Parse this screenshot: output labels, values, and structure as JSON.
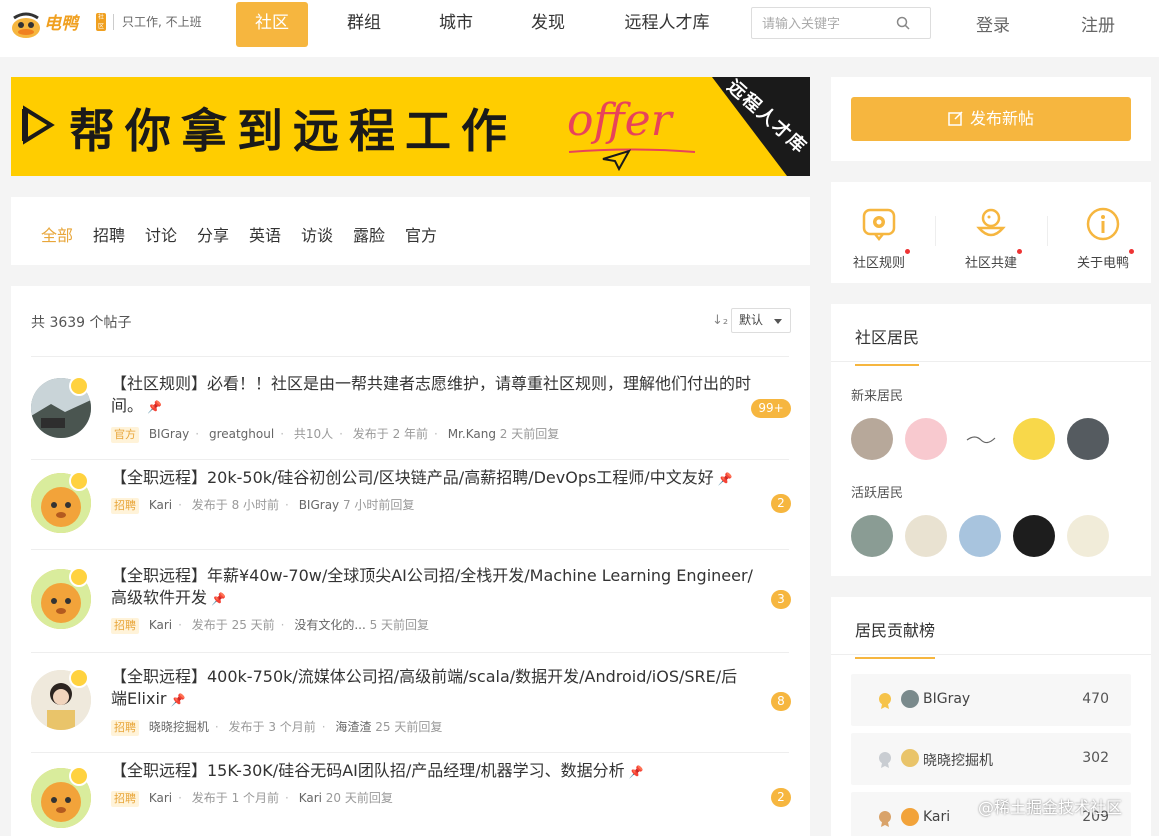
{
  "header": {
    "logo_text": "电鸭",
    "logo_badge": "社区",
    "slogan": "只工作, 不上班",
    "nav": [
      {
        "label": "社区",
        "active": true
      },
      {
        "label": "群组",
        "active": false
      },
      {
        "label": "城市",
        "active": false
      },
      {
        "label": "发现",
        "active": false
      },
      {
        "label": "远程人才库",
        "active": false
      }
    ],
    "search_placeholder": "请输入关键字",
    "login": "登录",
    "register": "注册"
  },
  "banner": {
    "title": "帮你拿到远程工作",
    "offer": "offer",
    "tag": "远程人才库"
  },
  "tabs": [
    "全部",
    "招聘",
    "讨论",
    "分享",
    "英语",
    "访谈",
    "露脸",
    "官方"
  ],
  "posts_header": {
    "count_text": "共 3639 个帖子",
    "sort_icon": "↓₂",
    "sort_value": "默认"
  },
  "posts": [
    {
      "title_lines": [
        "【社区规则】必看！！社区是由一帮共建者志愿维护，请尊重社区规则，理解他们付出的时",
        "间。"
      ],
      "tag": "官方",
      "author": "BIGray",
      "extra": "greatghoul",
      "participants": "共10人",
      "published": "发布于 2 年前",
      "last_replier": "Mr.Kang",
      "last_reply_time": "2 天前回复",
      "replies": "99+"
    },
    {
      "title_lines": [
        "【全职远程】20k-50k/硅谷初创公司/区块链产品/高薪招聘/DevOps工程师/中文友好"
      ],
      "tag": "招聘",
      "author": "Kari",
      "published": "发布于 8 小时前",
      "last_replier": "BIGray",
      "last_reply_time": "7 小时前回复",
      "replies": "2"
    },
    {
      "title_lines": [
        "【全职远程】年薪¥40w-70w/全球顶尖AI公司招/全栈开发/Machine Learning Engineer/",
        "高级软件开发"
      ],
      "tag": "招聘",
      "author": "Kari",
      "published": "发布于 25 天前",
      "last_replier": "没有文化的...",
      "last_reply_time": "5 天前回复",
      "replies": "3"
    },
    {
      "title_lines": [
        "【全职远程】400k-750k/流媒体公司招/高级前端/scala/数据开发/Android/iOS/SRE/后",
        "端Elixir"
      ],
      "tag": "招聘",
      "author": "晓晓挖掘机",
      "published": "发布于 3 个月前",
      "last_replier": "海渣渣",
      "last_reply_time": "25 天前回复",
      "replies": "8"
    },
    {
      "title_lines": [
        "【全职远程】15K-30K/硅谷无码AI团队招/产品经理/机器学习、数据分析"
      ],
      "tag": "招聘",
      "author": "Kari",
      "published": "发布于 1 个月前",
      "last_replier": "Kari",
      "last_reply_time": "20 天前回复",
      "replies": "2"
    }
  ],
  "sidebar": {
    "publish_label": "发布新帖",
    "quick_links": [
      {
        "label": "社区规则",
        "icon": "gear-chat-icon"
      },
      {
        "label": "社区共建",
        "icon": "duck-icon"
      },
      {
        "label": "关于电鸭",
        "icon": "info-icon"
      }
    ],
    "residents_title": "社区居民",
    "new_residents_label": "新来居民",
    "active_residents_label": "活跃居民",
    "ranking_title": "居民贡献榜",
    "ranking": [
      {
        "name": "BIGray",
        "score": "470"
      },
      {
        "name": "晓晓挖掘机",
        "score": "302"
      },
      {
        "name": "Kari",
        "score": "209"
      }
    ]
  },
  "watermark": "@稀土掘金技术社区",
  "colors": {
    "accent": "#f6b63f",
    "banner_yellow": "#ffcd00",
    "offer_red": "#e8435a"
  }
}
